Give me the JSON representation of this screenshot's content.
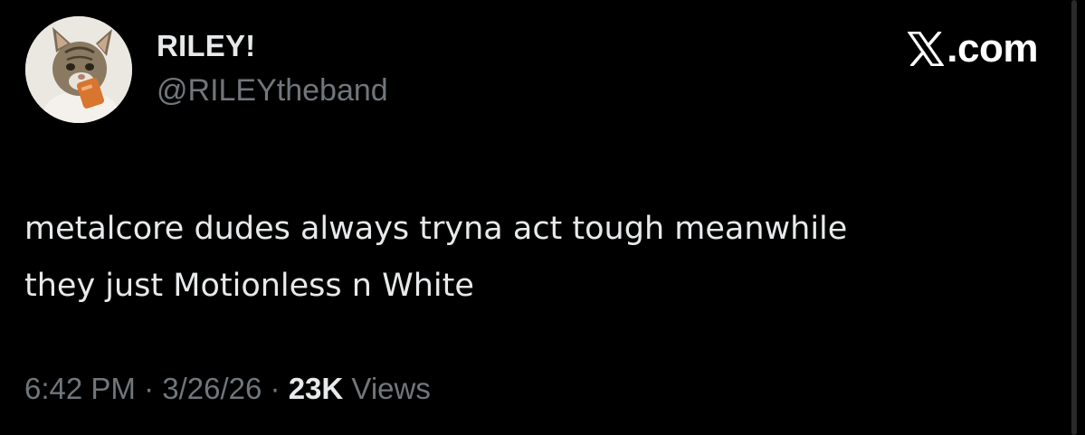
{
  "user": {
    "display_name": "RILEY!",
    "handle": "@RILEYtheband",
    "avatar_icon": "cat-avatar-icon"
  },
  "watermark": {
    "logo_icon": "x-logo-icon",
    "text": ".com"
  },
  "tweet": {
    "text_lines": [
      "metalcore dudes always tryna act tough meanwhile",
      "they just Motionless n White"
    ]
  },
  "meta": {
    "time": "6:42 PM",
    "separator": "·",
    "date": "3/26/26",
    "views_count": "23K",
    "views_label": "Views"
  },
  "colors": {
    "background": "#000000",
    "primary_text": "#e7e9ea",
    "secondary_text": "#71767b"
  }
}
